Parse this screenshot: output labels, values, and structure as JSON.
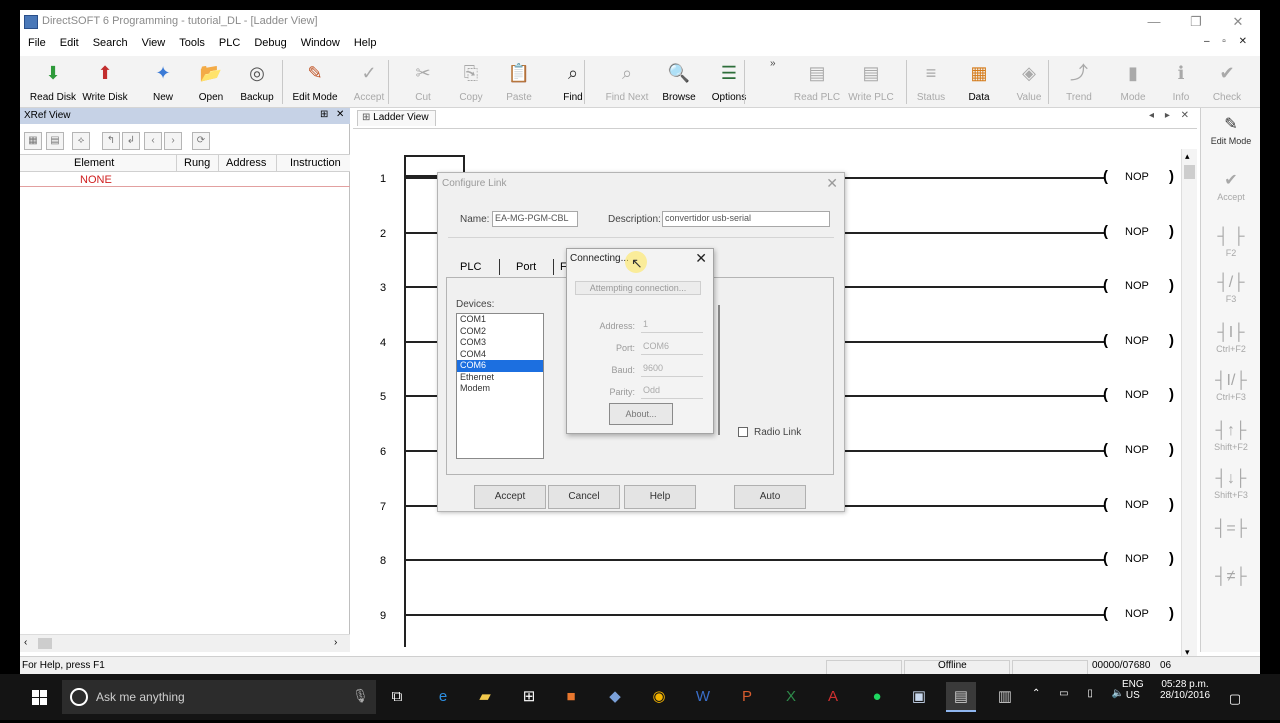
{
  "window": {
    "title": "DirectSOFT 6 Programming - tutorial_DL - [Ladder View]",
    "controls": [
      "—",
      "❐",
      "✕"
    ]
  },
  "menu": [
    "File",
    "Edit",
    "Search",
    "View",
    "Tools",
    "PLC",
    "Debug",
    "Window",
    "Help"
  ],
  "toolbar": [
    {
      "label": "Read Disk",
      "icon": "read-disk-icon",
      "enabled": true
    },
    {
      "label": "Write Disk",
      "icon": "write-disk-icon",
      "enabled": true
    },
    {
      "label": "New",
      "icon": "new-icon",
      "enabled": true
    },
    {
      "label": "Open",
      "icon": "open-icon",
      "enabled": true
    },
    {
      "label": "Backup",
      "icon": "backup-icon",
      "enabled": true
    },
    {
      "label": "Edit Mode",
      "icon": "edit-mode-icon",
      "enabled": true
    },
    {
      "label": "Accept",
      "icon": "accept-icon",
      "enabled": false
    },
    {
      "label": "Cut",
      "icon": "cut-icon",
      "enabled": false
    },
    {
      "label": "Copy",
      "icon": "copy-icon",
      "enabled": false
    },
    {
      "label": "Paste",
      "icon": "paste-icon",
      "enabled": false
    },
    {
      "label": "Find",
      "icon": "find-icon",
      "enabled": true
    },
    {
      "label": "Find Next",
      "icon": "find-next-icon",
      "enabled": false
    },
    {
      "label": "Browse",
      "icon": "browse-icon",
      "enabled": true
    },
    {
      "label": "Options",
      "icon": "options-icon",
      "enabled": true
    },
    {
      "label": "Read PLC",
      "icon": "read-plc-icon",
      "enabled": false
    },
    {
      "label": "Write PLC",
      "icon": "write-plc-icon",
      "enabled": false
    },
    {
      "label": "Status",
      "icon": "status-icon",
      "enabled": false
    },
    {
      "label": "Data",
      "icon": "data-icon",
      "enabled": true
    },
    {
      "label": "Value",
      "icon": "value-icon",
      "enabled": false
    },
    {
      "label": "Trend",
      "icon": "trend-icon",
      "enabled": false
    },
    {
      "label": "Mode",
      "icon": "mode-icon",
      "enabled": false
    },
    {
      "label": "Info",
      "icon": "info-icon",
      "enabled": false
    },
    {
      "label": "Check",
      "icon": "check-icon",
      "enabled": false
    }
  ],
  "xref": {
    "title": "XRef View",
    "columns": [
      "Element",
      "Rung",
      "Address",
      "Instruction"
    ],
    "empty": "NONE"
  },
  "ladder": {
    "tab": "Ladder View",
    "rungs": [
      {
        "n": "1",
        "coil": "NOP"
      },
      {
        "n": "2",
        "coil": "NOP"
      },
      {
        "n": "3",
        "coil": "NOP"
      },
      {
        "n": "4",
        "coil": "NOP"
      },
      {
        "n": "5",
        "coil": "NOP"
      },
      {
        "n": "6",
        "coil": "NOP"
      },
      {
        "n": "7",
        "coil": "NOP"
      },
      {
        "n": "8",
        "coil": "NOP"
      },
      {
        "n": "9",
        "coil": "NOP"
      }
    ]
  },
  "palette": [
    {
      "label": "Edit Mode",
      "icon": "edit-mode-icon"
    },
    {
      "label": "Accept",
      "icon": "accept-icon"
    },
    {
      "label": "F2",
      "icon": "contact-no-icon"
    },
    {
      "label": "F3",
      "icon": "contact-nc-icon"
    },
    {
      "label": "Ctrl+F2",
      "icon": "immediate-contact-icon"
    },
    {
      "label": "Ctrl+F3",
      "icon": "immediate-nc-contact-icon"
    },
    {
      "label": "Shift+F2",
      "icon": "edge-contact-icon"
    },
    {
      "label": "Shift+F3",
      "icon": "edge-nc-contact-icon"
    },
    {
      "label": "",
      "icon": "compare-contact-icon"
    },
    {
      "label": "",
      "icon": "compare-nc-contact-icon"
    }
  ],
  "statusbar": {
    "help": "For Help, press F1",
    "mode": "Offline",
    "memory": "00000/07680",
    "count": "06"
  },
  "configure_link": {
    "title": "Configure Link",
    "name_label": "Name:",
    "name_value": "EA-MG-PGM-CBL",
    "desc_label": "Description:",
    "desc_value": "convertidor usb-serial",
    "tabs": [
      "PLC",
      "Port",
      "F"
    ],
    "devices_label": "Devices:",
    "devices": [
      "COM1",
      "COM2",
      "COM3",
      "COM4",
      "COM6",
      "Ethernet",
      "Modem"
    ],
    "selected_device": "COM6",
    "radio_link_label": "Radio Link",
    "buttons": {
      "accept": "Accept",
      "cancel": "Cancel",
      "help": "Help",
      "auto": "Auto"
    }
  },
  "connecting": {
    "title": "Connecting...",
    "status": "Attempting connection...",
    "address_label": "Address:",
    "address_value": "1",
    "port_label": "Port:",
    "port_value": "COM6",
    "baud_label": "Baud:",
    "baud_value": "9600",
    "parity_label": "Parity:",
    "parity_value": "Odd",
    "about_label": "About..."
  },
  "taskbar": {
    "search_placeholder": "Ask me anything",
    "lang": "ENG",
    "region": "US",
    "time": "05:28 p.m.",
    "date": "28/10/2016"
  }
}
